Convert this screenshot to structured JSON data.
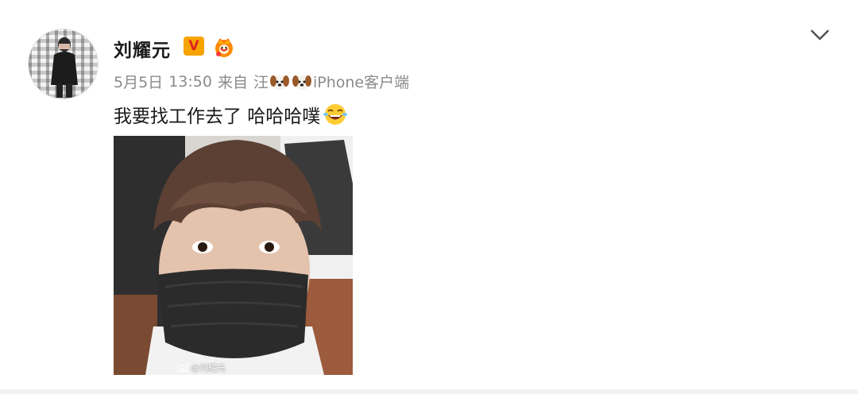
{
  "post": {
    "author": {
      "name": "刘耀元",
      "vip_badge": "V"
    },
    "meta": {
      "date": "5月5日",
      "time": "13:50",
      "from_label": "来自",
      "source_prefix": "汪",
      "source_suffix": "iPhone客户端"
    },
    "text": "我要找工作去了 哈哈哈噗",
    "image": {
      "watermark": "@刘耀元"
    }
  },
  "colors": {
    "meta_gray": "#8b8b8b",
    "vip_orange": "#f7a300",
    "vip_red": "#e0241c",
    "text": "#1a1a1a"
  },
  "icons": [
    "avatar",
    "vip-badge",
    "crown-icon",
    "chevron-down-icon",
    "dog-emoji",
    "laughing-emoji",
    "weibo-logo-icon"
  ]
}
